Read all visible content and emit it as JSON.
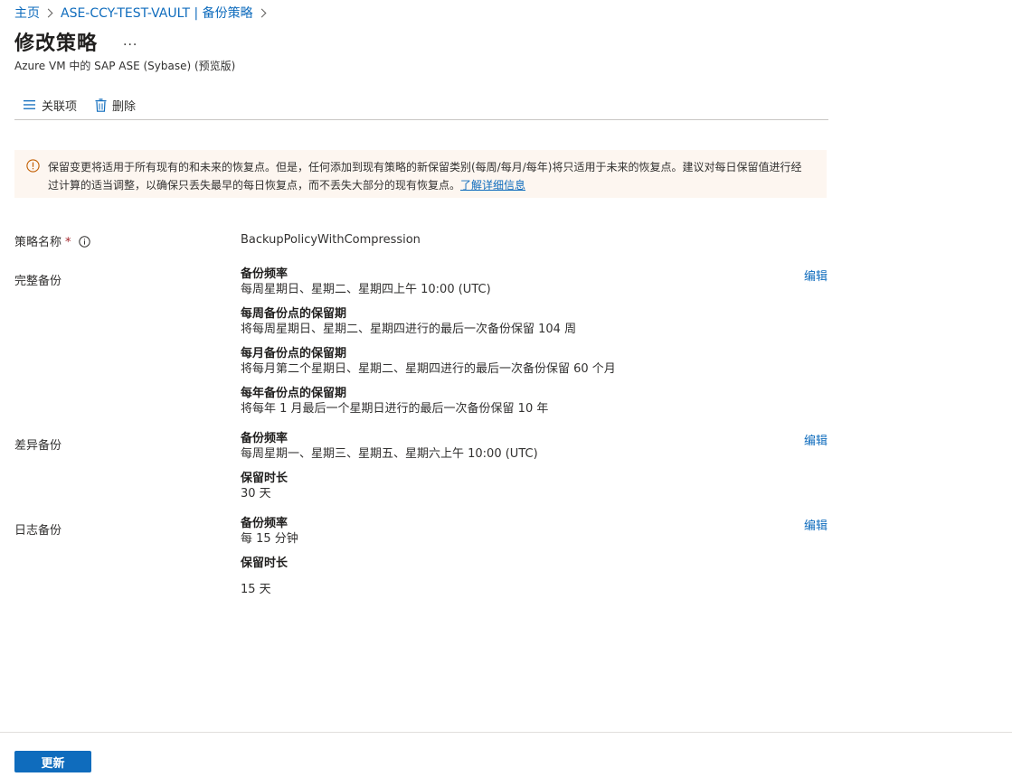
{
  "breadcrumb": {
    "home": "主页",
    "vault": "ASE-CCY-TEST-VAULT | 备份策略"
  },
  "header": {
    "title": "修改策略",
    "more": "...",
    "subtitle": "Azure VM 中的 SAP ASE (Sybase) (预览版)"
  },
  "toolbar": {
    "associate_label": "关联项",
    "delete_label": "删除"
  },
  "banner": {
    "text": "保留变更将适用于所有现有的和未来的恢复点。但是，任何添加到现有策略的新保留类别(每周/每月/每年)将只适用于未来的恢复点。建议对每日保留值进行经过计算的适当调整，以确保只丢失最早的每日恢复点，而不丢失大部分的现有恢复点。",
    "link": "了解详细信息"
  },
  "policy_name": {
    "label": "策略名称",
    "required": "*",
    "value": "BackupPolicyWithCompression"
  },
  "full_backup": {
    "label": "完整备份",
    "edit": "编辑",
    "freq_title": "备份频率",
    "freq_value": "每周星期日、星期二、星期四上午 10:00 (UTC)",
    "weekly_title": "每周备份点的保留期",
    "weekly_value": "将每周星期日、星期二、星期四进行的最后一次备份保留 104 周",
    "monthly_title": "每月备份点的保留期",
    "monthly_value": "将每月第二个星期日、星期二、星期四进行的最后一次备份保留 60 个月",
    "yearly_title": "每年备份点的保留期",
    "yearly_value": "将每年 1 月最后一个星期日进行的最后一次备份保留 10 年"
  },
  "diff_backup": {
    "label": "差异备份",
    "edit": "编辑",
    "freq_title": "备份频率",
    "freq_value": "每周星期一、星期三、星期五、星期六上午 10:00 (UTC)",
    "ret_title": "保留时长",
    "ret_value": "30 天"
  },
  "log_backup": {
    "label": "日志备份",
    "edit": "编辑",
    "freq_title": "备份频率",
    "freq_value": "每 15 分钟",
    "ret_title": "保留时长",
    "ret_value": "15 天"
  },
  "footer": {
    "update_label": "更新"
  }
}
